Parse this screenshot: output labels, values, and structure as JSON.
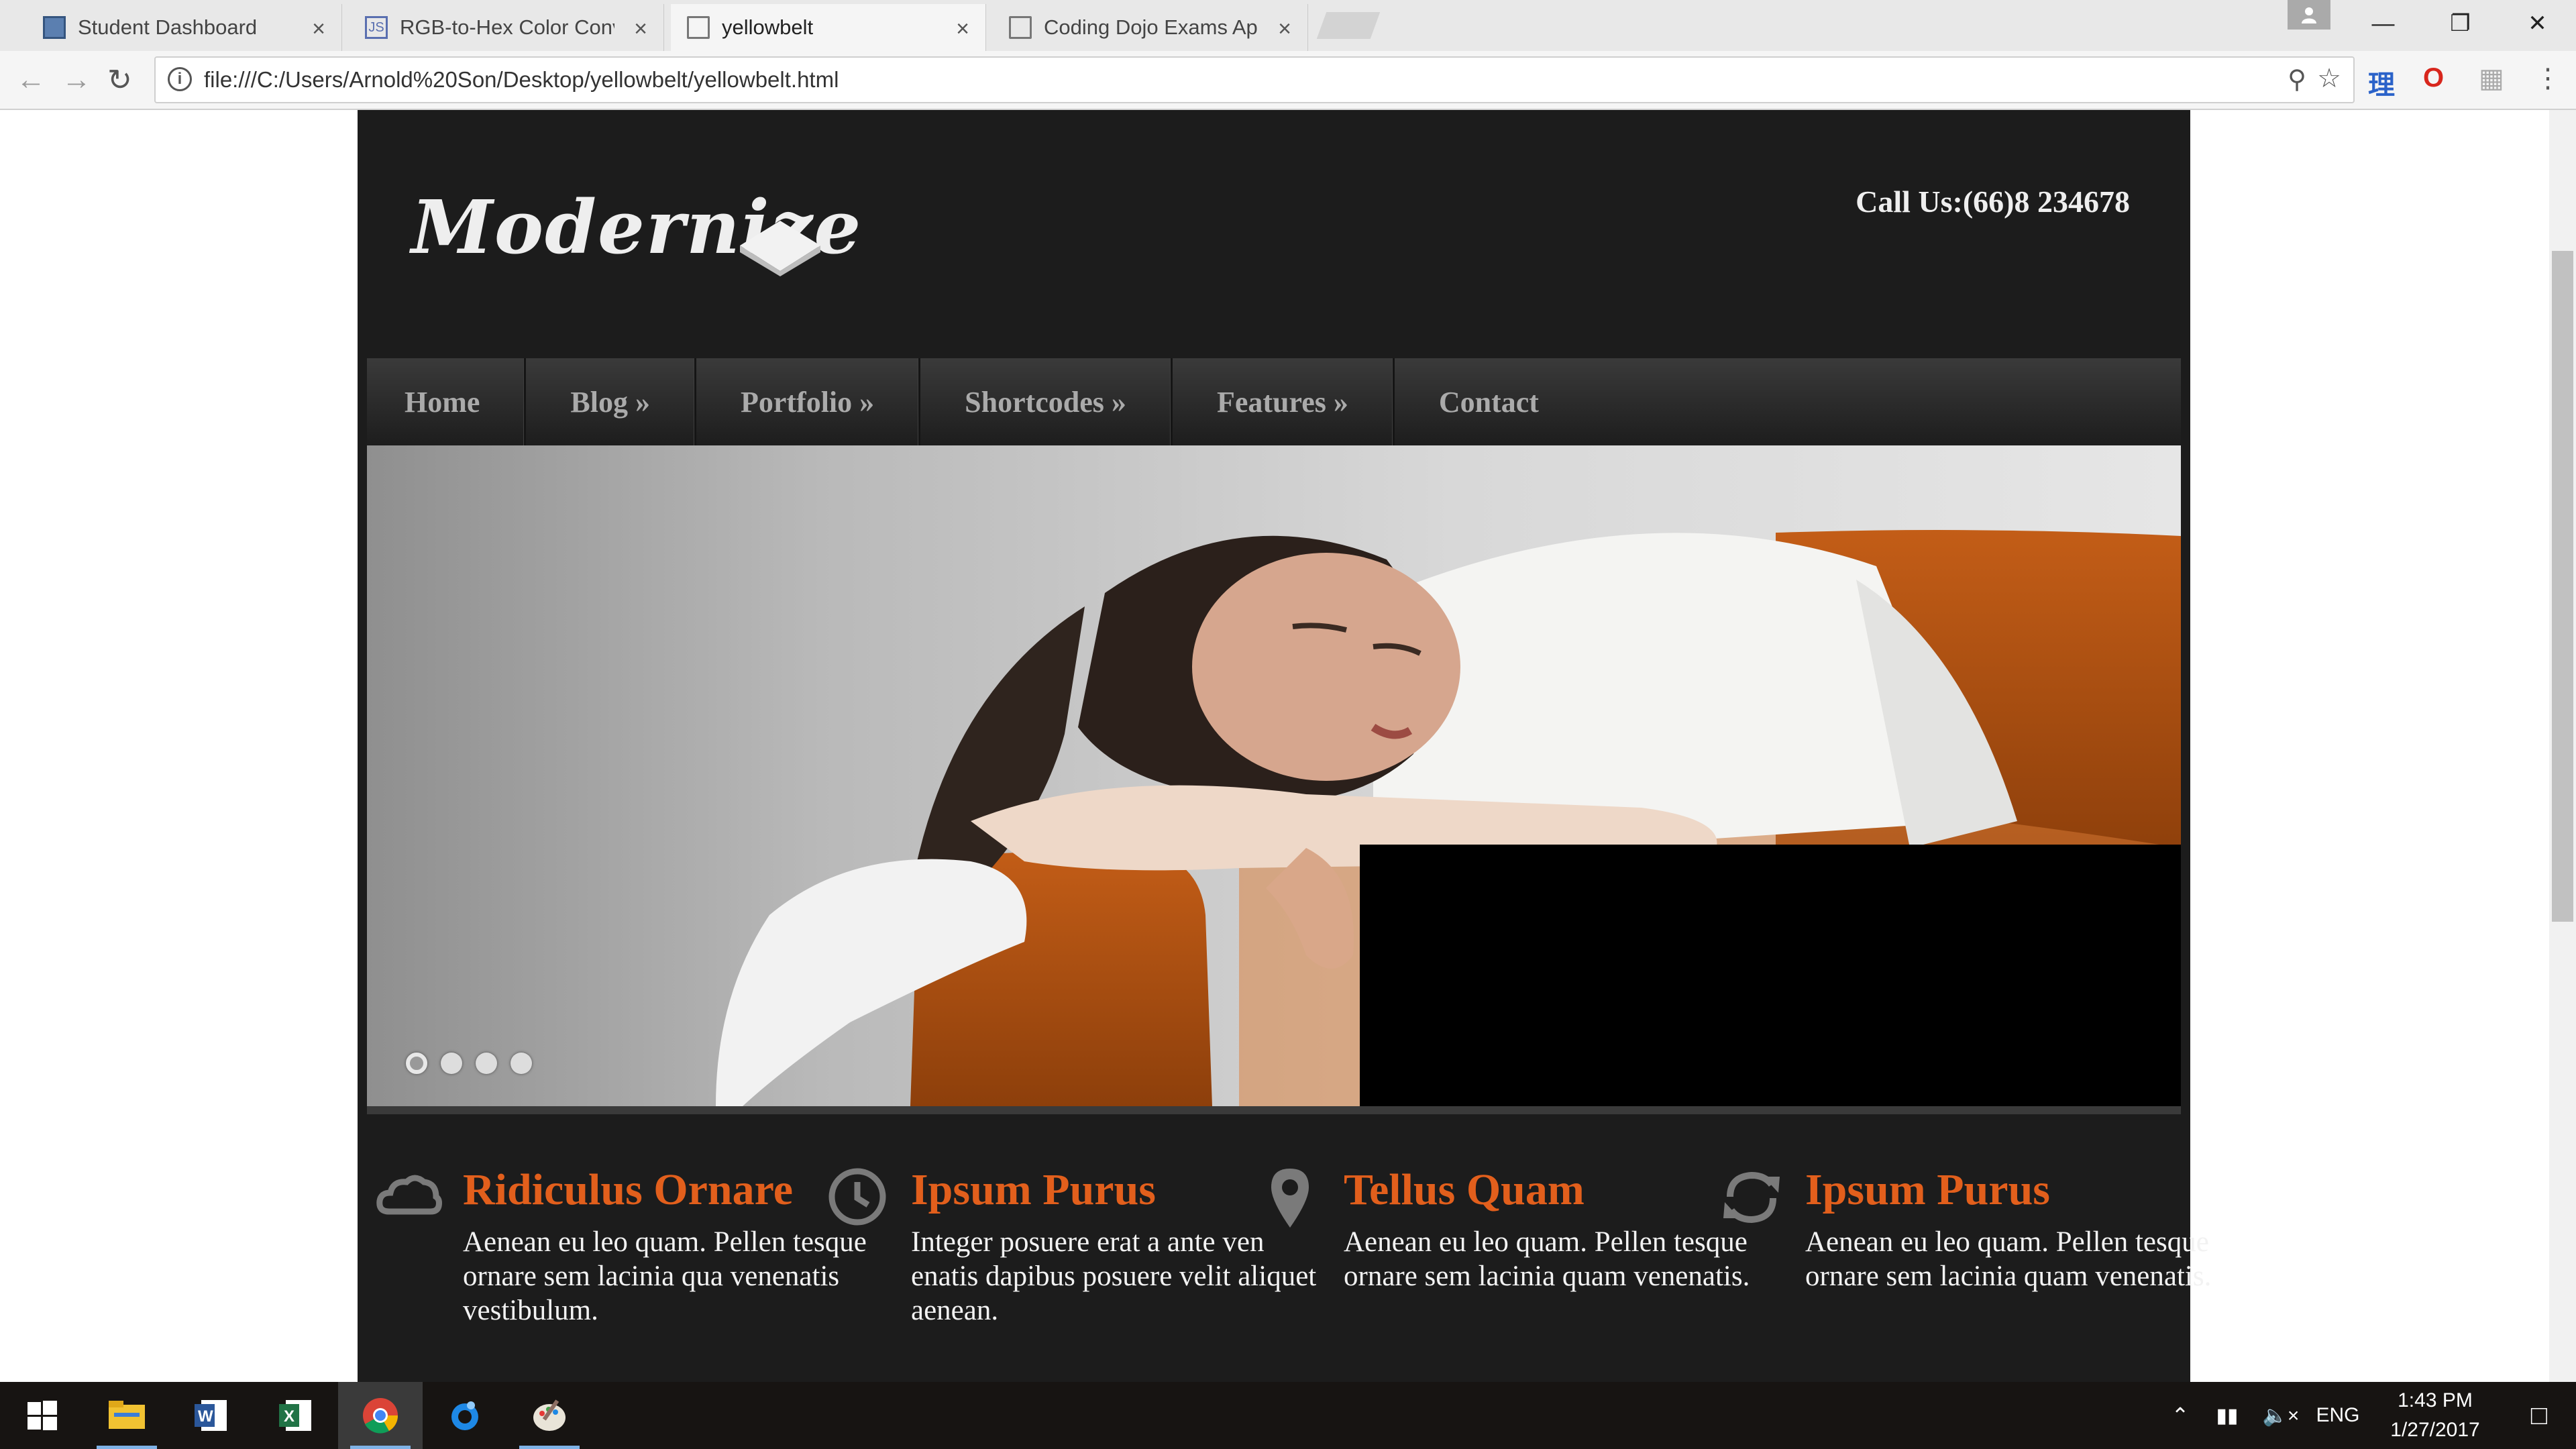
{
  "browser": {
    "tabs": [
      {
        "title": "Student Dashboard",
        "active": false
      },
      {
        "title": "RGB-to-Hex Color Conve",
        "active": false
      },
      {
        "title": "yellowbelt",
        "active": true
      },
      {
        "title": "Coding Dojo Exams App",
        "active": false
      }
    ],
    "url": "file:///C:/Users/Arnold%20Son/Desktop/yellowbelt/yellowbelt.html",
    "tab_close": "×"
  },
  "site": {
    "logo": "Modernize",
    "phone": "Call Us:(66)8 234678",
    "nav": [
      "Home",
      "Blog »",
      "Portfolio »",
      "Shortcodes »",
      "Features »",
      "Contact"
    ],
    "slider": {
      "dot_count": 4,
      "active_dot": 0
    },
    "features": [
      {
        "icon": "cloud-icon",
        "title": "Ridiculus Ornare",
        "text": "Aenean eu leo quam. Pellen tesque ornare sem lacinia qua venenatis vestibulum."
      },
      {
        "icon": "clock-icon",
        "title": "Ipsum Purus",
        "text": "Integer posuere erat a ante ven enatis dapibus posuere velit aliquet aenean."
      },
      {
        "icon": "map-pin-icon",
        "title": "Tellus Quam",
        "text": "Aenean eu leo quam. Pellen tesque ornare sem lacinia quam venenatis."
      },
      {
        "icon": "refresh-icon",
        "title": "Ipsum Purus",
        "text": "Aenean eu leo quam. Pellen tesque ornare sem lacinia quam venenatis."
      }
    ],
    "colors": {
      "accent": "#e25f1c",
      "background": "#1c1c1c",
      "nav_text": "#aaaaaa"
    }
  },
  "taskbar": {
    "apps": [
      "windows-start-icon",
      "file-explorer-icon",
      "word-icon",
      "excel-icon",
      "chrome-icon",
      "app-icon",
      "paint-icon"
    ],
    "language": "ENG",
    "time": "1:43 PM",
    "date": "1/27/2017"
  }
}
